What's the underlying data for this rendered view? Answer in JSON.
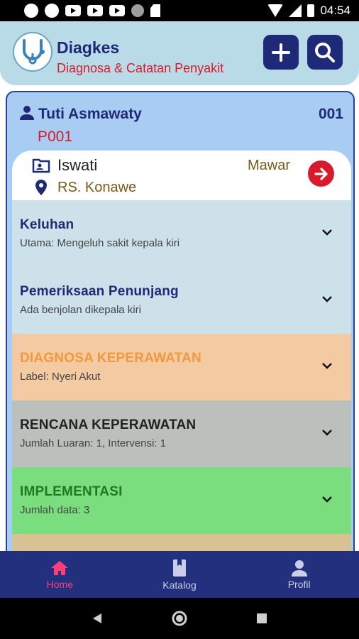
{
  "status_bar": {
    "time": "04:54"
  },
  "header": {
    "title": "Diagkes",
    "subtitle": "Diagnosa & Catatan Penyakit",
    "add_icon": "plus-icon",
    "search_icon": "search-icon"
  },
  "patient": {
    "name": "Tuti Asmawaty",
    "number": "001",
    "code": "P001",
    "nurse": "Iswati",
    "room": "Mawar",
    "hospital": "RS. Konawe"
  },
  "sections": [
    {
      "title": "Keluhan",
      "subtitle": "Utama: Mengeluh sakit kepala kiri",
      "bg": "#cce1ea",
      "color": "#1e2a78"
    },
    {
      "title": "Pemeriksaan Penunjang",
      "subtitle": "Ada benjolan dikepala kiri",
      "bg": "#cce1ea",
      "color": "#1e2a78"
    },
    {
      "title": "DIAGNOSA KEPERAWATAN",
      "subtitle": "Label: Nyeri Akut",
      "bg": "#f3caa2",
      "color": "#f0993f"
    },
    {
      "title": "RENCANA KEPERAWATAN",
      "subtitle": "Jumlah Luaran: 1, Intervensi: 1",
      "bg": "#bcc0bd",
      "color": "#222222"
    },
    {
      "title": "IMPLEMENTASI",
      "subtitle": "Jumlah data: 3",
      "bg": "#7bde7e",
      "color": "#1d7a22"
    },
    {
      "title": "",
      "subtitle": "",
      "bg": "#d8c294",
      "color": "#222222"
    }
  ],
  "bottom_nav": {
    "items": [
      {
        "label": "Home",
        "icon": "home-icon"
      },
      {
        "label": "Katalog",
        "icon": "book-icon"
      },
      {
        "label": "Profil",
        "icon": "person-icon"
      }
    ]
  },
  "colors": {
    "brand": "#1e2a78",
    "accent": "#d81b2c",
    "nav_active": "#ff3d7a"
  }
}
